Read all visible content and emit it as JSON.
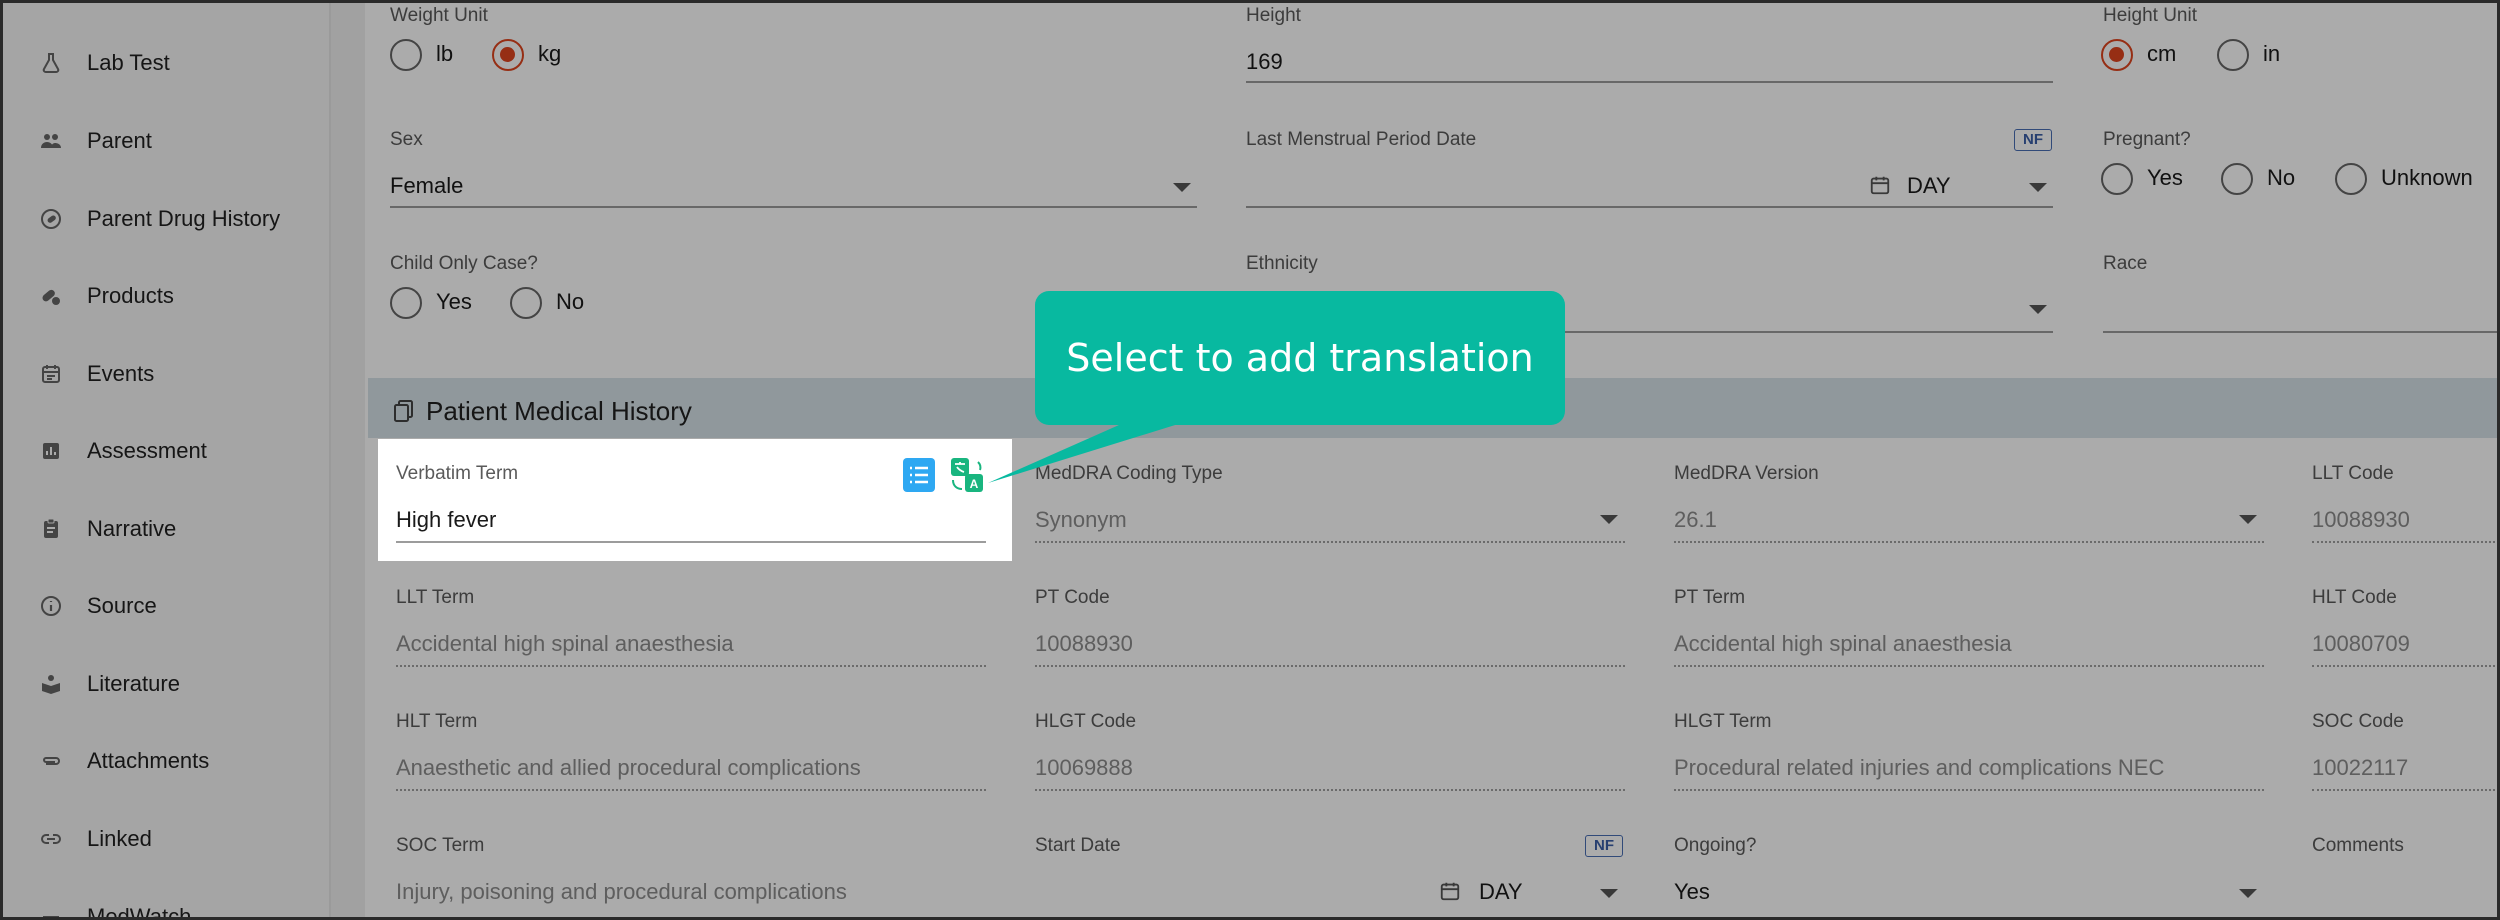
{
  "sidebar": {
    "items": [
      {
        "label": "Lab Test",
        "icon": "flask-icon"
      },
      {
        "label": "Parent",
        "icon": "people-icon"
      },
      {
        "label": "Parent Drug History",
        "icon": "history-pill-icon"
      },
      {
        "label": "Products",
        "icon": "pills-icon"
      },
      {
        "label": "Events",
        "icon": "calendar-icon"
      },
      {
        "label": "Assessment",
        "icon": "bar-chart-icon"
      },
      {
        "label": "Narrative",
        "icon": "clipboard-icon"
      },
      {
        "label": "Source",
        "icon": "info-icon"
      },
      {
        "label": "Literature",
        "icon": "book-icon"
      },
      {
        "label": "Attachments",
        "icon": "paperclip-icon"
      },
      {
        "label": "Linked",
        "icon": "link-icon"
      },
      {
        "label": "MedWatch",
        "icon": "medwatch-icon"
      }
    ]
  },
  "patient": {
    "weight_unit": {
      "label": "Weight Unit",
      "options": [
        "lb",
        "kg"
      ],
      "selected": "kg"
    },
    "height": {
      "label": "Height",
      "value": "169"
    },
    "height_unit": {
      "label": "Height Unit",
      "options": [
        "cm",
        "in"
      ],
      "selected": "cm"
    },
    "sex": {
      "label": "Sex",
      "value": "Female"
    },
    "lmp_date": {
      "label": "Last Menstrual Period Date",
      "badge": "NF",
      "unit": "DAY"
    },
    "pregnant": {
      "label": "Pregnant?",
      "options": [
        "Yes",
        "No",
        "Unknown"
      ]
    },
    "child_only": {
      "label": "Child Only Case?",
      "options": [
        "Yes",
        "No"
      ]
    },
    "ethnicity": {
      "label": "Ethnicity"
    },
    "race": {
      "label": "Race"
    }
  },
  "medical_history": {
    "title": "Patient Medical History",
    "verbatim_term": {
      "label": "Verbatim Term",
      "value": "High fever"
    },
    "meddra_coding_type": {
      "label": "MedDRA Coding Type",
      "value": "Synonym"
    },
    "meddra_version": {
      "label": "MedDRA Version",
      "value": "26.1"
    },
    "llt_code": {
      "label": "LLT Code",
      "value": "10088930"
    },
    "llt_term": {
      "label": "LLT Term",
      "value": "Accidental high spinal anaesthesia"
    },
    "pt_code": {
      "label": "PT Code",
      "value": "10088930"
    },
    "pt_term": {
      "label": "PT Term",
      "value": "Accidental high spinal anaesthesia"
    },
    "hlt_code": {
      "label": "HLT Code",
      "value": "10080709"
    },
    "hlt_term": {
      "label": "HLT Term",
      "value": "Anaesthetic and allied procedural complications"
    },
    "hlgt_code": {
      "label": "HLGT Code",
      "value": "10069888"
    },
    "hlgt_term": {
      "label": "HLGT Term",
      "value": "Procedural related injuries and complications NEC"
    },
    "soc_code": {
      "label": "SOC Code",
      "value": "10022117"
    },
    "soc_term": {
      "label": "SOC Term",
      "value": "Injury, poisoning and procedural complications"
    },
    "start_date": {
      "label": "Start Date",
      "badge": "NF",
      "unit": "DAY"
    },
    "ongoing": {
      "label": "Ongoing?",
      "value": "Yes"
    },
    "comments": {
      "label": "Comments"
    }
  },
  "tooltip": {
    "text": "Select to add translation"
  },
  "colors": {
    "accent": "#e0451f",
    "tooltip": "#08b9a0",
    "section_bar": "#d7e3e9",
    "list_icon": "#2ea8f2",
    "translate_icon": "#19b57f",
    "nf_badge": "#3b5fa8"
  }
}
